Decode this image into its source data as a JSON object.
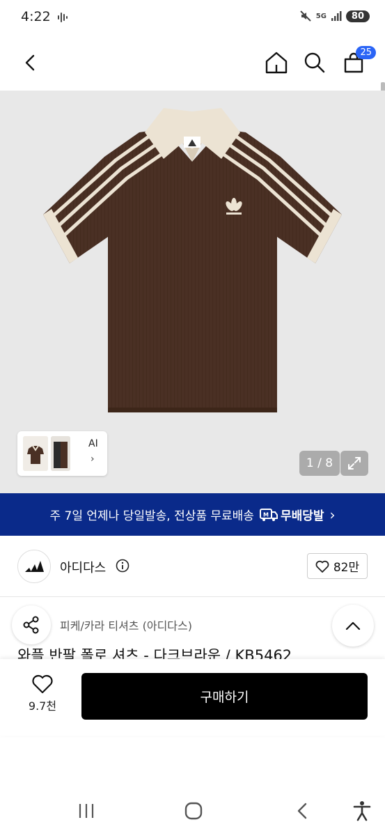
{
  "status_bar": {
    "time": "4:22",
    "network": "5G",
    "battery": "80"
  },
  "nav": {
    "cart_count": "25"
  },
  "gallery": {
    "ai_label": "AI",
    "ai_arrow": "›",
    "page_counter": "1 / 8"
  },
  "banner": {
    "text": "주 7일 언제나 당일발송, 전상품 무료배송",
    "logo_mark": "M",
    "logo_text": "무배당발",
    "arrow": "›"
  },
  "brand": {
    "name": "아디다스",
    "likes": "82만"
  },
  "product": {
    "category": "피케/카라 티셔츠 (아디다스)",
    "title": "와플 반팔 폴로 셔츠 - 다크브라운 / KB5462"
  },
  "bottom": {
    "wish_count": "9.7천",
    "buy_label": "구매하기"
  },
  "colors": {
    "banner_bg": "#0a2a8a",
    "cart_badge": "#2a64f6",
    "buy_bg": "#000000",
    "shirt_body": "#4a3024",
    "shirt_trim": "#ece3d3"
  },
  "icons": [
    "back-icon",
    "home-icon",
    "search-icon",
    "bag-icon",
    "expand-icon",
    "adidas-logo",
    "info-icon",
    "heart-icon",
    "share-icon",
    "chevron-up-icon",
    "recents-icon",
    "home-nav-icon",
    "back-nav-icon",
    "accessibility-icon"
  ]
}
